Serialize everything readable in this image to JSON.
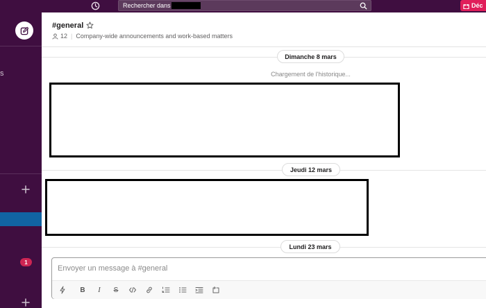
{
  "topbar": {
    "search_label": "Rechercher dans",
    "upgrade_label": "Déc"
  },
  "sidebar": {
    "partial_text": "s",
    "badge_count": "1"
  },
  "channel": {
    "name": "#general",
    "member_count": "12",
    "description": "Company-wide announcements and work-based matters"
  },
  "messages": {
    "day1": "Dimanche 8 mars",
    "loading": "Chargement de l'historique...",
    "day2": "Jeudi 12 mars",
    "day3": "Lundi 23 mars"
  },
  "composer": {
    "placeholder": "Envoyer un message à #general"
  },
  "colors": {
    "sidebar_bg": "#3f0e40",
    "active_item": "#1164a3",
    "badge": "#cd2553",
    "upgrade": "#e01e5a"
  }
}
